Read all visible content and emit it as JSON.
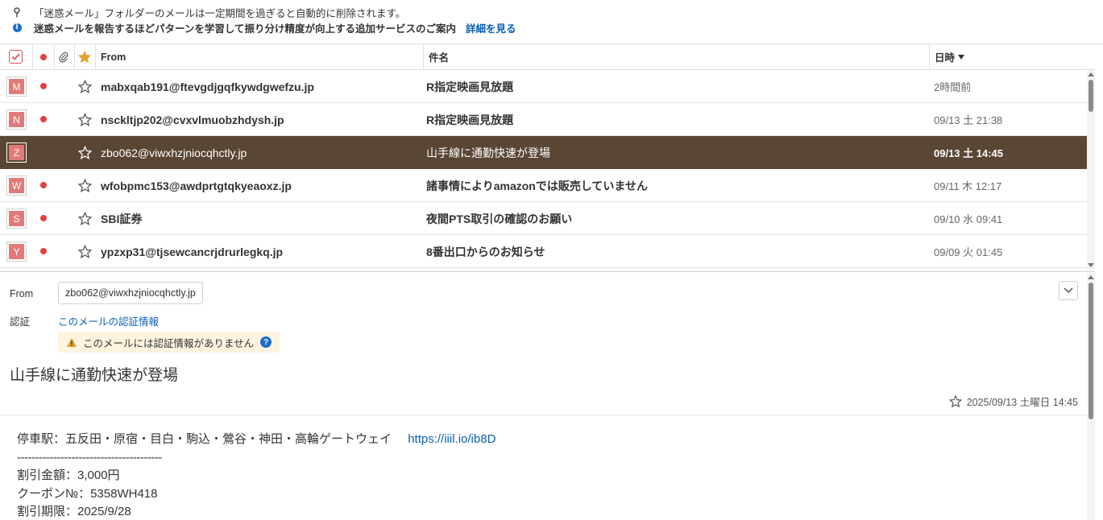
{
  "notices": {
    "line1": "「迷惑メール」フォルダーのメールは一定期間を過ぎると自動的に削除されます。",
    "line2": "迷惑メールを報告するほどパターンを学習して振り分け精度が向上する追加サービスのご案内",
    "detail_link": "詳細を見る"
  },
  "list_header": {
    "from": "From",
    "subject": "件名",
    "date": "日時"
  },
  "messages": [
    {
      "initial": "M",
      "from": "mabxqab191@ftevgdjgqfkywdgwefzu.jp",
      "subject": "R指定映画見放題",
      "date": "2時間前",
      "unread": true,
      "selected": false
    },
    {
      "initial": "N",
      "from": "nsckltjp202@cvxvlmuobzhdysh.jp",
      "subject": "R指定映画見放題",
      "date": "09/13 土 21:38",
      "unread": true,
      "selected": false
    },
    {
      "initial": "Z",
      "from": "zbo062@viwxhzjniocqhctly.jp",
      "subject": "山手線に通勤快速が登場",
      "date": "09/13 土 14:45",
      "unread": false,
      "selected": true
    },
    {
      "initial": "W",
      "from": "wfobpmc153@awdprtgtqkyeaoxz.jp",
      "subject": "諸事情によりamazonでは販売していません",
      "date": "09/11 木 12:17",
      "unread": true,
      "selected": false
    },
    {
      "initial": "S",
      "from": "SBI証券",
      "subject": "夜間PTS取引の確認のお願い",
      "date": "09/10 水 09:41",
      "unread": true,
      "selected": false
    },
    {
      "initial": "Y",
      "from": "ypzxp31@tjsewcancrjdrurlegkq.jp",
      "subject": "8番出口からのお知らせ",
      "date": "09/09 火 01:45",
      "unread": true,
      "selected": false
    }
  ],
  "preview": {
    "from_label": "From",
    "from_value": "zbo062@viwxhzjniocqhctly.jp",
    "auth_label": "認証",
    "auth_link": "このメールの認証情報",
    "auth_warning": "このメールには認証情報がありません",
    "subject": "山手線に通勤快速が登場",
    "date": "2025/09/13 土曜日 14:45",
    "body": {
      "line1": "停車駅：五反田・原宿・目白・駒込・鶯谷・神田・高輪ゲートウェイ",
      "url": "https://iiil.io/ib8D",
      "separator": "----------------------------------------",
      "line2": "割引金額：3,000円",
      "line3": "クーポン№：5358WH418",
      "line4": "割引期限：2025/9/28"
    }
  },
  "colors": {
    "selected_row": "#5a4634",
    "avatar": "#e27a7a",
    "unread_dot": "#e24141",
    "link": "#0b5fb3",
    "star_header": "#e0a22b"
  }
}
